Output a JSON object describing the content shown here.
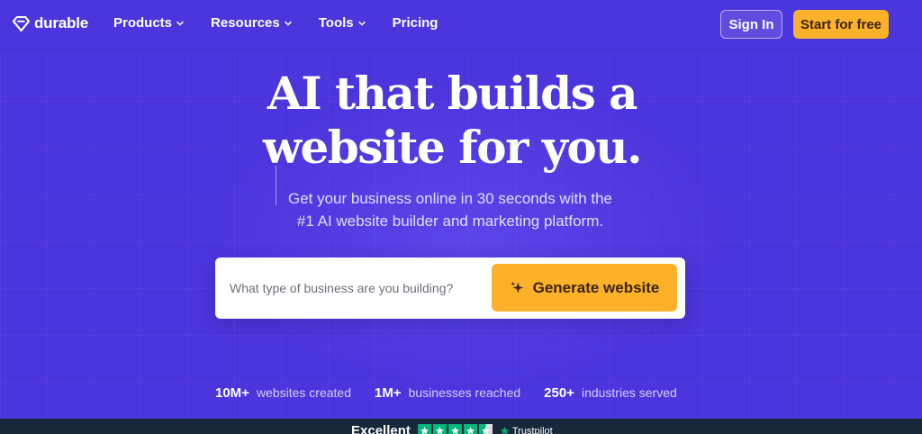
{
  "brand": {
    "name": "durable",
    "icon": "diamond-logo-icon"
  },
  "nav": {
    "items": [
      {
        "label": "Products",
        "has_dropdown": true
      },
      {
        "label": "Resources",
        "has_dropdown": true
      },
      {
        "label": "Tools",
        "has_dropdown": true
      },
      {
        "label": "Pricing",
        "has_dropdown": false
      }
    ],
    "sign_in": "Sign In",
    "start": "Start for free"
  },
  "hero": {
    "headline_line1": "AI that builds a",
    "headline_line2": "website for you.",
    "sub_line1": "Get your business online in 30 seconds with the",
    "sub_line2": "#1 AI website builder and marketing platform.",
    "search_placeholder": "What type of business are you building?",
    "generate_label": "Generate website",
    "generate_icon": "sparkle-icon"
  },
  "stats": [
    {
      "value": "10M+",
      "label": "websites created"
    },
    {
      "value": "1M+",
      "label": "businesses reached"
    },
    {
      "value": "250+",
      "label": "industries served"
    }
  ],
  "review": {
    "rating_text": "Excellent",
    "stars": 4.5,
    "brand": "Trustpilot"
  },
  "colors": {
    "background": "#4b35dc",
    "accent": "#fbb12a",
    "button_text": "#3b2416",
    "bottom_bar": "#16283a",
    "trustpilot_green": "#00b67a"
  }
}
